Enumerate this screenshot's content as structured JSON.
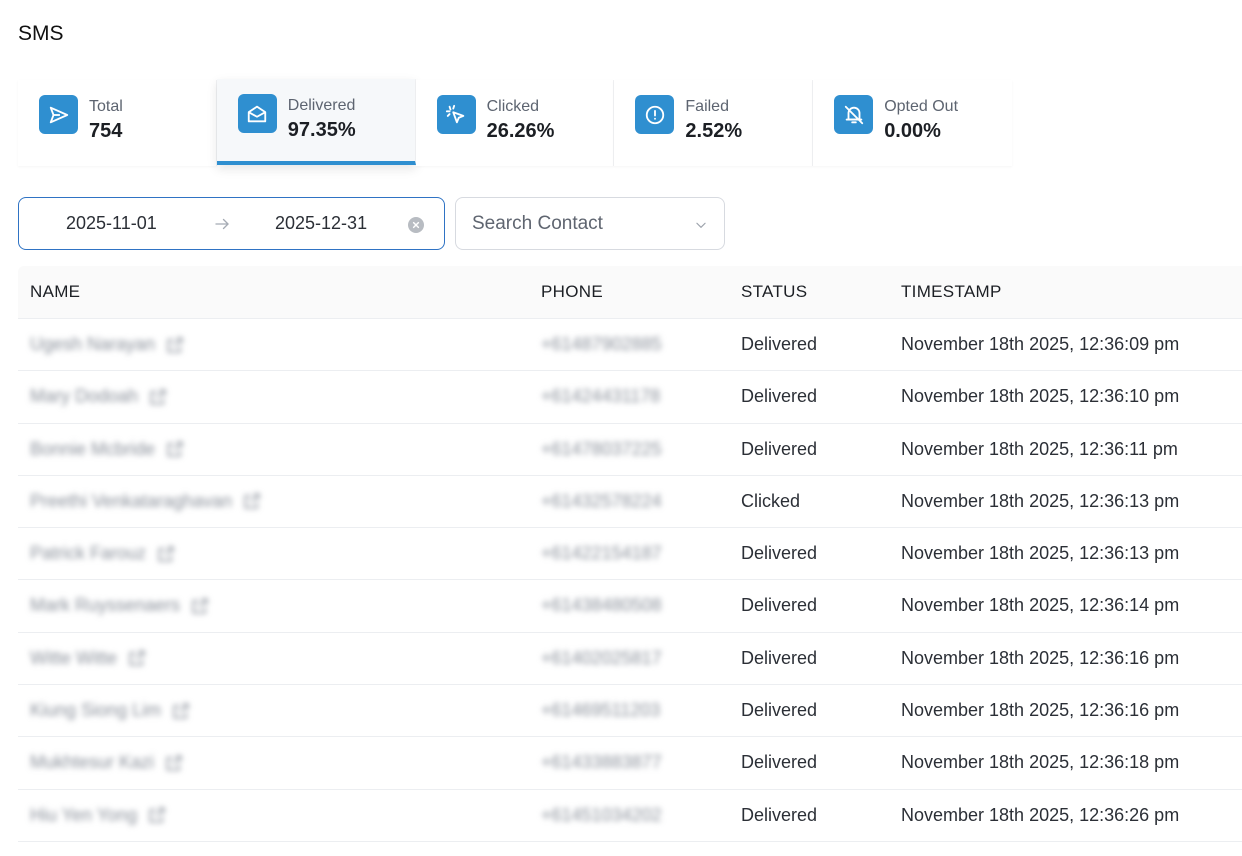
{
  "page": {
    "title": "SMS"
  },
  "colors": {
    "accent": "#2f8fd0",
    "active_border": "#2f73c4"
  },
  "stats": [
    {
      "label": "Total",
      "value": "754",
      "icon": "send-icon",
      "active": false
    },
    {
      "label": "Delivered",
      "value": "97.35%",
      "icon": "mail-open-icon",
      "active": true
    },
    {
      "label": "Clicked",
      "value": "26.26%",
      "icon": "cursor-click-icon",
      "active": false
    },
    {
      "label": "Failed",
      "value": "2.52%",
      "icon": "alert-circle-icon",
      "active": false
    },
    {
      "label": "Opted Out",
      "value": "0.00%",
      "icon": "bell-off-icon",
      "active": false
    }
  ],
  "filters": {
    "date_start": "2025-11-01",
    "date_end": "2025-12-31",
    "contact_placeholder": "Search Contact"
  },
  "table": {
    "headers": {
      "name": "NAME",
      "phone": "PHONE",
      "status": "STATUS",
      "timestamp": "TIMESTAMP"
    },
    "rows": [
      {
        "name": "Ugesh Narayan",
        "phone": "+61487902885",
        "status": "Delivered",
        "timestamp": "November 18th 2025, 12:36:09 pm"
      },
      {
        "name": "Mary Dodoah",
        "phone": "+61424431178",
        "status": "Delivered",
        "timestamp": "November 18th 2025, 12:36:10 pm"
      },
      {
        "name": "Bonnie Mcbride",
        "phone": "+61478037225",
        "status": "Delivered",
        "timestamp": "November 18th 2025, 12:36:11 pm"
      },
      {
        "name": "Preethi Venkataraghavan",
        "phone": "+61432578224",
        "status": "Clicked",
        "timestamp": "November 18th 2025, 12:36:13 pm"
      },
      {
        "name": "Patrick Farouz",
        "phone": "+61422154187",
        "status": "Delivered",
        "timestamp": "November 18th 2025, 12:36:13 pm"
      },
      {
        "name": "Mark Ruyssenaers",
        "phone": "+61438480508",
        "status": "Delivered",
        "timestamp": "November 18th 2025, 12:36:14 pm"
      },
      {
        "name": "Witte Witte",
        "phone": "+61402025817",
        "status": "Delivered",
        "timestamp": "November 18th 2025, 12:36:16 pm"
      },
      {
        "name": "Kiung Siong Lim",
        "phone": "+61469511203",
        "status": "Delivered",
        "timestamp": "November 18th 2025, 12:36:16 pm"
      },
      {
        "name": "Mukhtesur Kazi",
        "phone": "+61433883877",
        "status": "Delivered",
        "timestamp": "November 18th 2025, 12:36:18 pm"
      },
      {
        "name": "Hiu Yen Yong",
        "phone": "+61451034202",
        "status": "Delivered",
        "timestamp": "November 18th 2025, 12:36:26 pm"
      }
    ]
  }
}
